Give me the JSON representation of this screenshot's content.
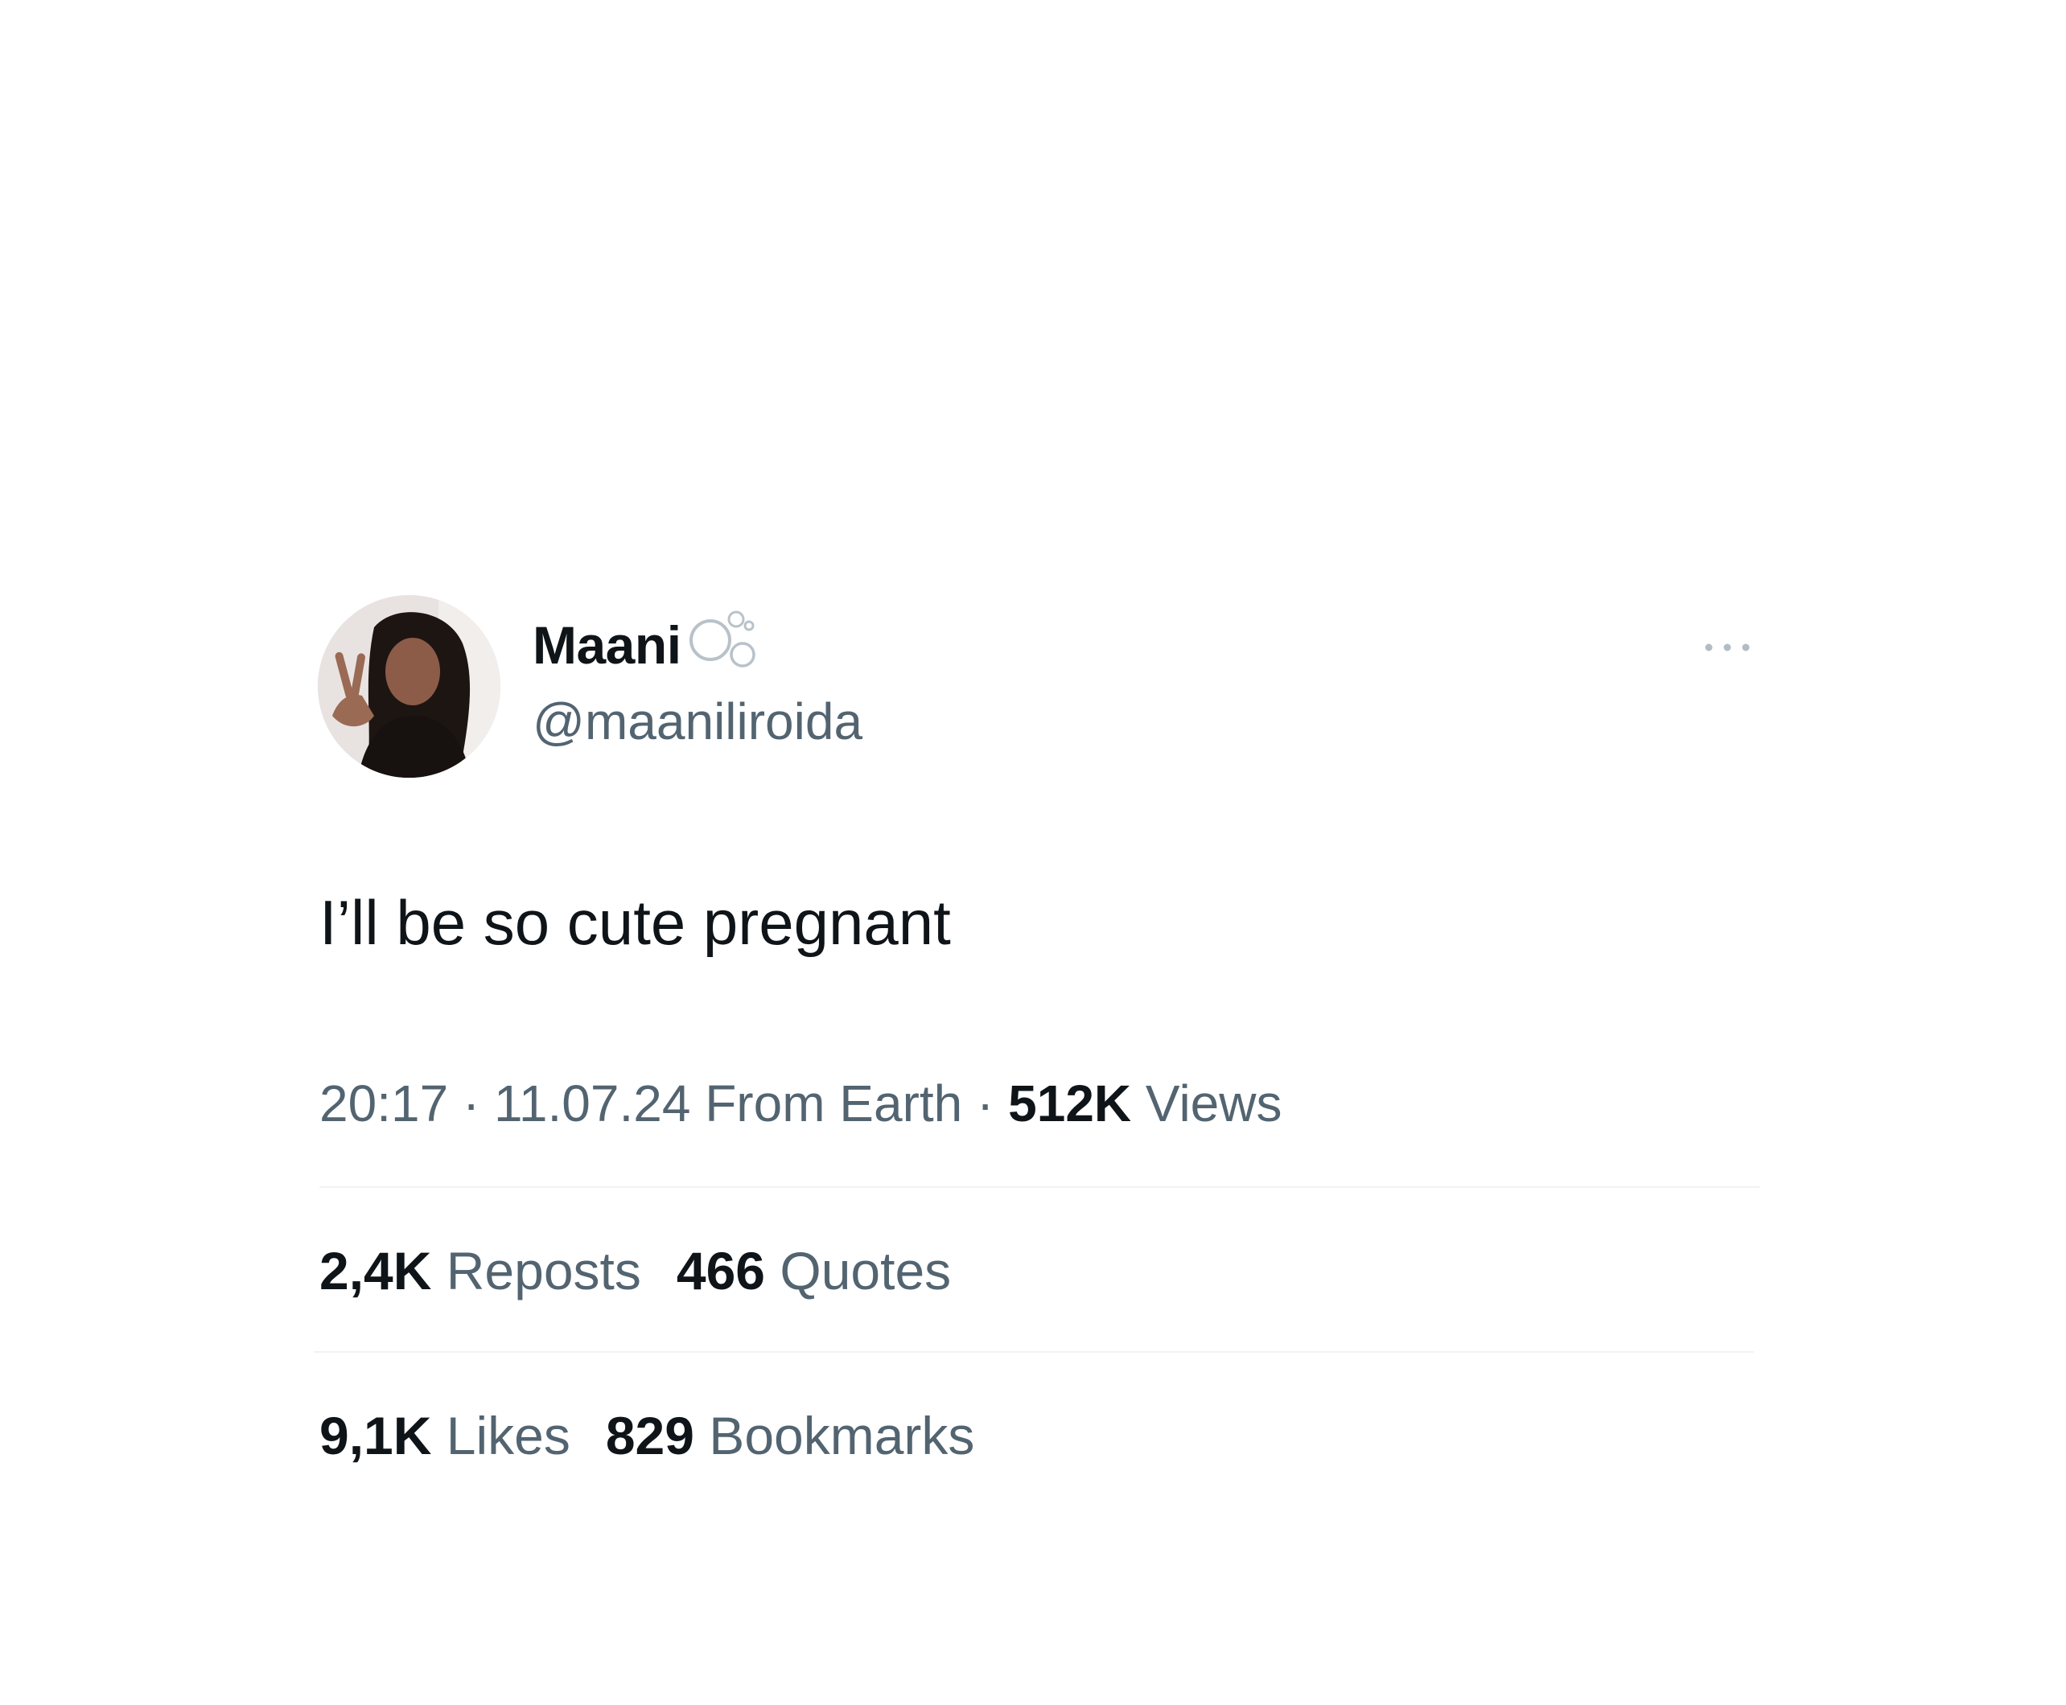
{
  "user": {
    "display_name": "Maani",
    "handle": "@maaniliroida",
    "badge_icon": "bubbles-icon",
    "avatar_icon": "avatar"
  },
  "menu": {
    "icon": "more-icon"
  },
  "tweet": {
    "text": "I’ll be so cute pregnant"
  },
  "meta": {
    "time": "20:17",
    "separator_1": " · ",
    "date": "11.07.24",
    "source": " From Earth",
    "separator_2": " · ",
    "views_count": "512K",
    "views_label": " Views"
  },
  "stats": {
    "reposts_count": "2,4K",
    "reposts_label": " Reposts",
    "quotes_count": "466",
    "quotes_label": " Quotes",
    "likes_count": "9,1K",
    "likes_label": " Likes",
    "bookmarks_count": "829",
    "bookmarks_label": " Bookmarks"
  },
  "colors": {
    "primary_text": "#0f1419",
    "secondary_text": "#536471",
    "divider": "#eff3f4",
    "background": "#ffffff"
  }
}
